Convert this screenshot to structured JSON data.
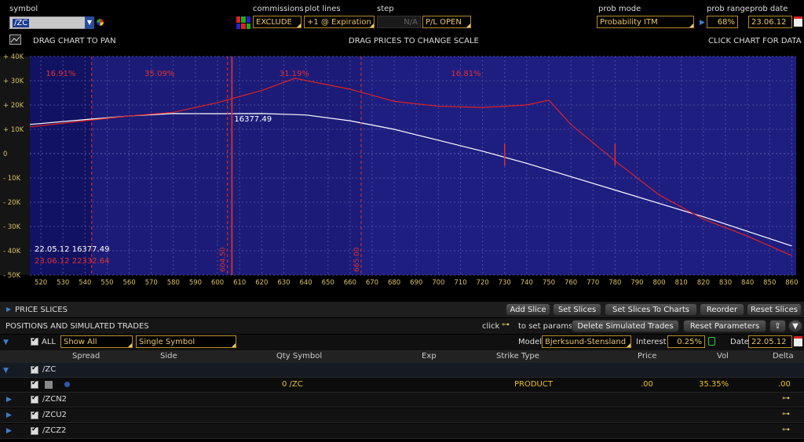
{
  "toolbar": {
    "symbol_label": "symbol",
    "symbol_value": "/ZC",
    "commissions_label": "commissions",
    "commissions_value": "EXCLUDE",
    "plot_lines_label": "plot lines",
    "plot_lines_value": "+1 @ Expiration",
    "step_label": "step",
    "step_value": "N/A",
    "pl_value": "P/L OPEN",
    "prob_mode_label": "prob mode",
    "prob_mode_value": "Probability ITM",
    "prob_range_label": "prob range",
    "prob_range_value": "68%",
    "prob_date_label": "prob date",
    "prob_date_value": "23.06.12"
  },
  "hints": {
    "drag_pan": "DRAG CHART TO PAN",
    "drag_prices": "DRAG PRICES TO CHANGE SCALE",
    "click_chart": "CLICK CHART FOR DATA"
  },
  "chart_data": {
    "type": "line",
    "x_ticks": [
      520,
      530,
      540,
      550,
      560,
      570,
      580,
      590,
      600,
      610,
      620,
      630,
      640,
      650,
      660,
      670,
      680,
      690,
      700,
      710,
      720,
      730,
      740,
      750,
      760,
      770,
      780,
      790,
      800,
      810,
      820,
      830,
      840,
      850,
      860
    ],
    "y_ticks": [
      "+ 40K",
      "+ 30K",
      "+ 20K",
      "+ 10K",
      "0",
      "- 10K",
      "- 20K",
      "- 30K",
      "- 40K",
      "- 50K"
    ],
    "ylim": [
      -50000,
      40000
    ],
    "xlim": [
      515,
      862
    ],
    "grid": true,
    "series": [
      {
        "color": "#ffffff",
        "x": [
          515,
          540,
          560,
          580,
          600,
          620,
          640,
          660,
          680,
          700,
          720,
          740,
          760,
          780,
          800,
          820,
          840,
          860
        ],
        "y": [
          12000,
          14000,
          15500,
          16500,
          16400,
          16500,
          15900,
          13500,
          10000,
          5500,
          1000,
          -4000,
          -9500,
          -15000,
          -20500,
          -26000,
          -32000,
          -38000
        ]
      },
      {
        "color": "#e02020",
        "x": [
          515,
          540,
          560,
          580,
          600,
          620,
          635,
          660,
          680,
          700,
          720,
          740,
          750,
          760,
          780,
          800,
          820,
          840,
          860
        ],
        "y": [
          11000,
          13500,
          15500,
          17000,
          21000,
          26000,
          31000,
          26500,
          21500,
          19500,
          19000,
          20000,
          22000,
          12000,
          -3000,
          -17000,
          -27000,
          -34000,
          -42000
        ]
      }
    ],
    "zones": [
      {
        "label": "16.91%",
        "x_from": 515,
        "x_to": 543
      },
      {
        "label": "35.09%",
        "x_from": 543,
        "x_to": 604.5
      },
      {
        "label": "31.19%",
        "x_from": 604.5,
        "x_to": 665
      },
      {
        "label": "16.81%",
        "x_from": 665,
        "x_to": 862
      }
    ],
    "markers": [
      {
        "label": "604.50",
        "x": 604.5
      },
      {
        "label": "665.00",
        "x": 665
      }
    ],
    "price_marker": {
      "x": 606.5,
      "label": "16377.49"
    },
    "tick_marks": [
      {
        "x": 730
      },
      {
        "x": 780
      }
    ],
    "readout": {
      "line1": "22.05.12  16377.49",
      "line2": "23.06.12  22332.64"
    }
  },
  "price_slices": {
    "title": "PRICE SLICES",
    "buttons": [
      "Add Slice",
      "Set Slices",
      "Set Slices To Charts",
      "Reorder",
      "Reset Slices"
    ]
  },
  "positions": {
    "title": "POSITIONS AND SIMULATED TRADES",
    "click_text": "click",
    "set_params_text": "to set params",
    "delete_button": "Delete Simulated Trades",
    "reset_button": "Reset Parameters",
    "all_label": "ALL",
    "show_all": "Show All",
    "single_symbol": "Single Symbol",
    "model_label": "Model",
    "model_value": "Bjerksund-Stensland",
    "interest_label": "Interest",
    "interest_value": "0.25%",
    "date_label": "Date",
    "date_value": "22.05.12",
    "columns": {
      "spread": "Spread",
      "side": "Side",
      "qty_symbol": "Qty Symbol",
      "exp": "Exp",
      "strike_type": "Strike Type",
      "price": "Price",
      "vol": "Vol",
      "delta": "Delta"
    },
    "group_zc": "/ZC",
    "position_row": {
      "qty_symbol": "0 /ZC",
      "type": "PRODUCT",
      "price": ".00",
      "vol": "35.35%",
      "delta": ".00"
    },
    "sub_rows": [
      "/ZCN2",
      "/ZCU2",
      "/ZCZ2"
    ]
  }
}
